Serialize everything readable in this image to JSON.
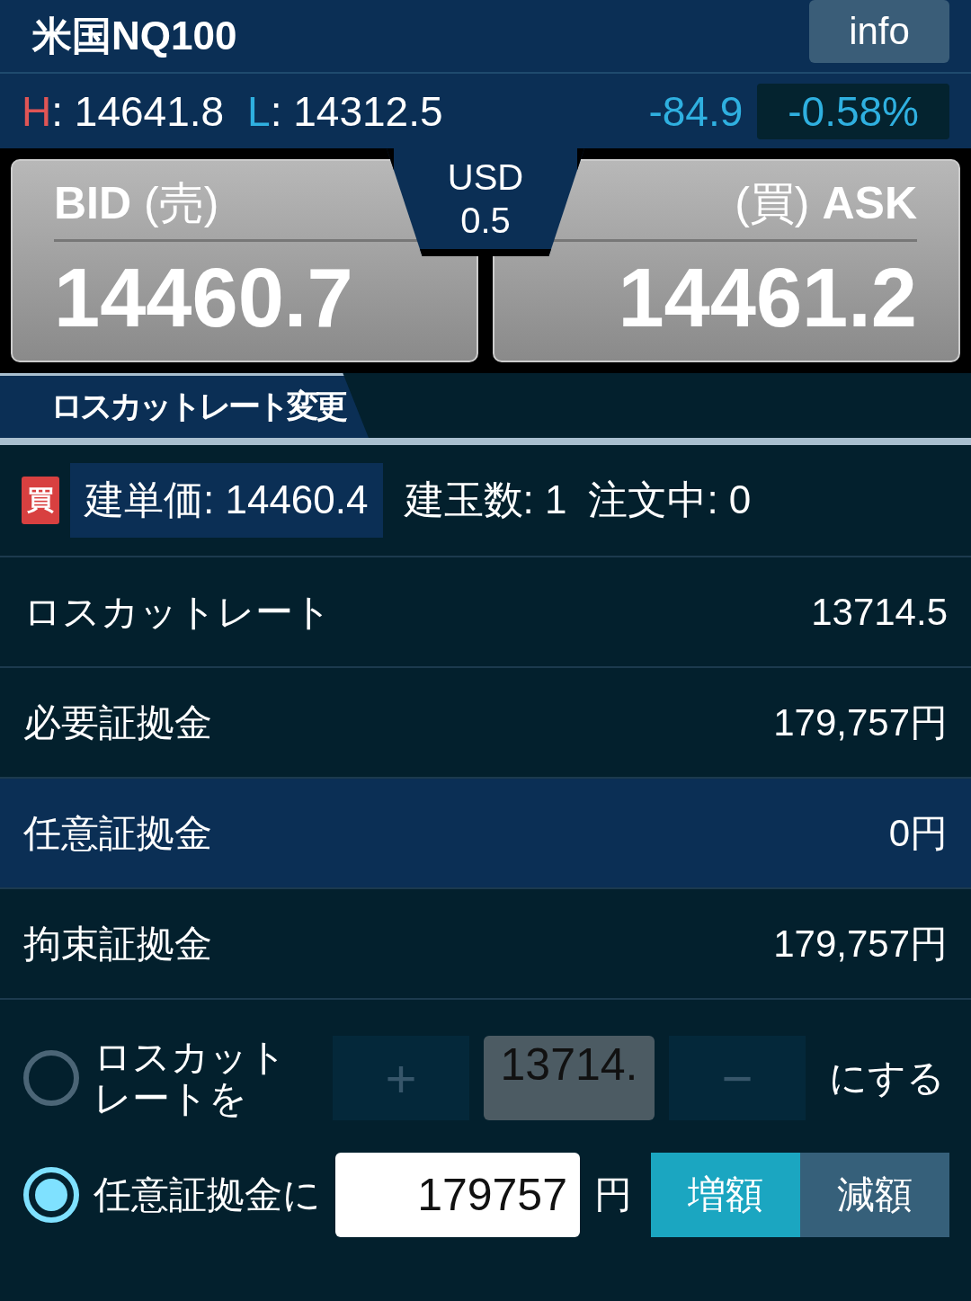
{
  "header": {
    "title": "米国NQ100",
    "info_button": "info"
  },
  "range": {
    "high_label": "H",
    "high": ": 14641.8",
    "low_label": "L",
    "low": ": 14312.5",
    "change": "-84.9",
    "change_pct": "-0.58%"
  },
  "quote": {
    "bid_label": "BID",
    "bid_sub": "(売)",
    "bid": "14460.7",
    "spread_unit": "USD",
    "spread": "0.5",
    "ask_sub": "(買)",
    "ask_label": "ASK",
    "ask": "14461.2"
  },
  "tab": {
    "label": "ロスカットレート変更",
    "selected": true
  },
  "position": {
    "side": "買",
    "price": "建単価: 14460.4",
    "count": "建玉数: 1",
    "pending": "注文中: 0"
  },
  "rows": [
    {
      "label": "ロスカットレート",
      "value": "13714.5",
      "highlighted": false
    },
    {
      "label": "必要証拠金",
      "value": "179,757円",
      "highlighted": false
    },
    {
      "label": "任意証拠金",
      "value": "0円",
      "highlighted": true
    },
    {
      "label": "拘束証拠金",
      "value": "179,757円",
      "highlighted": false
    }
  ],
  "options": [
    {
      "kind": "rate",
      "selected": false,
      "label_lines": [
        "ロスカット",
        "レートを"
      ],
      "plus": "+",
      "value": "13714.",
      "minus": "−",
      "suffix": "にする"
    },
    {
      "kind": "margin",
      "selected": true,
      "label": "任意証拠金に",
      "value": "179757",
      "unit": "円",
      "toggles": [
        {
          "label": "増額",
          "selected": true
        },
        {
          "label": "減額",
          "selected": false
        }
      ]
    }
  ]
}
